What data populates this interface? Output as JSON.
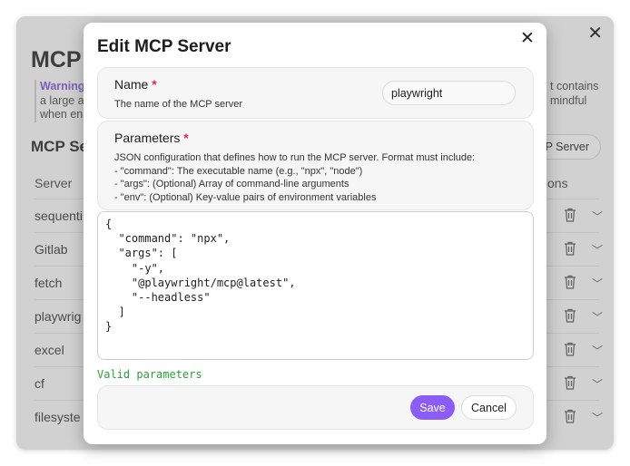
{
  "background": {
    "title_fragment": "MCP",
    "warning_label": "Warning",
    "warning_left_lines": [
      "a large ar",
      "when ena"
    ],
    "warning_right_lines": [
      "t contains",
      "mindful"
    ],
    "section_title_fragment": "MCP Se",
    "add_button_fragment": "P Server",
    "col_server": "Server",
    "col_actions_fragment": "tions",
    "rows": [
      "sequenti",
      "Gitlab",
      "fetch",
      "playwrig",
      "excel",
      "cf",
      "filesyste"
    ]
  },
  "modal": {
    "title": "Edit MCP Server",
    "name": {
      "label": "Name",
      "required_mark": "*",
      "description": "The name of the MCP server",
      "value": "playwright"
    },
    "parameters": {
      "label": "Parameters",
      "required_mark": "*",
      "description_lines": [
        "JSON configuration that defines how to run the MCP server. Format must include:",
        "- \"command\": The executable name (e.g., \"npx\", \"node\")",
        "- \"args\": (Optional) Array of command-line arguments",
        "- \"env\": (Optional) Key-value pairs of environment variables"
      ],
      "json_value": "{\n  \"command\": \"npx\",\n  \"args\": [\n    \"-y\",\n    \"@playwright/mcp@latest\",\n    \"--headless\"\n  ]\n}"
    },
    "validation_message": "Valid parameters",
    "save_label": "Save",
    "cancel_label": "Cancel"
  },
  "colors": {
    "accent": "#8b5cf6",
    "valid": "#2ba13a",
    "required": "#e0245e",
    "warning_label": "#7b54d6"
  }
}
